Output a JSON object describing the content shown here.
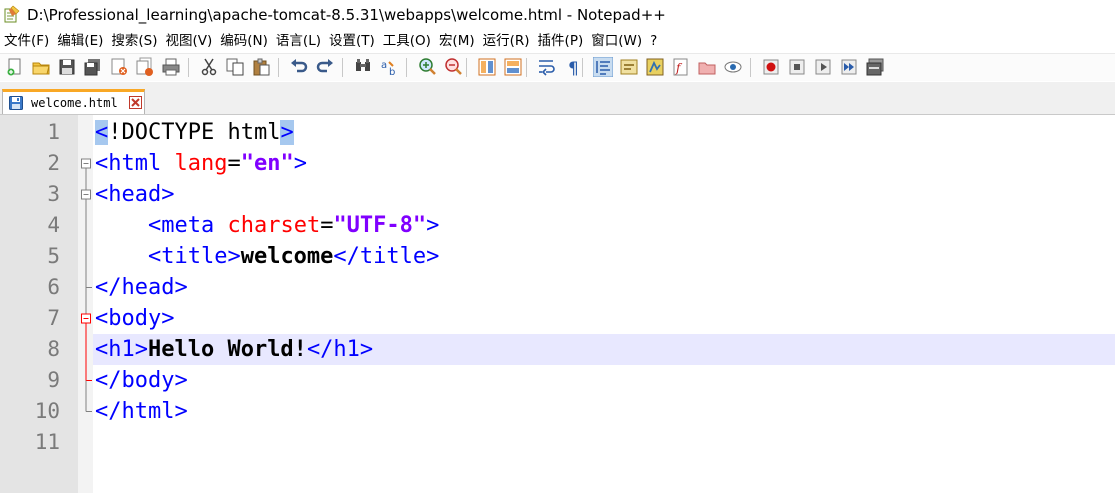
{
  "window": {
    "title": "D:\\Professional_learning\\apache-tomcat-8.5.31\\webapps\\welcome.html - Notepad++",
    "app_icon": "notepad-plus-plus-icon"
  },
  "menu": [
    {
      "label": "文件(F)"
    },
    {
      "label": "编辑(E)"
    },
    {
      "label": "搜索(S)"
    },
    {
      "label": "视图(V)"
    },
    {
      "label": "编码(N)"
    },
    {
      "label": "语言(L)"
    },
    {
      "label": "设置(T)"
    },
    {
      "label": "工具(O)"
    },
    {
      "label": "宏(M)"
    },
    {
      "label": "运行(R)"
    },
    {
      "label": "插件(P)"
    },
    {
      "label": "窗口(W)"
    },
    {
      "label": "?"
    }
  ],
  "toolbar": {
    "buttons": [
      "new-file-icon",
      "open-file-icon",
      "save-icon",
      "save-all-icon",
      "close-icon",
      "close-all-icon",
      "print-icon",
      "cut-icon",
      "copy-icon",
      "paste-icon",
      "undo-icon",
      "redo-icon",
      "find-icon",
      "replace-icon",
      "zoom-in-icon",
      "zoom-out-icon",
      "sync-vertical-icon",
      "sync-horizontal-icon",
      "word-wrap-icon",
      "show-all-characters-icon",
      "indent-guide-icon",
      "user-language-icon",
      "document-map-icon",
      "function-list-icon",
      "folder-as-workspace-icon",
      "monitoring-icon",
      "record-macro-icon",
      "stop-recording-icon",
      "playback-icon",
      "run-macro-multiple-icon",
      "save-macro-icon"
    ],
    "active_button": "indent-guide-icon"
  },
  "tabs": [
    {
      "label": "welcome.html",
      "icon": "saved-file-icon",
      "close_icon": "tab-close-icon",
      "active": true
    }
  ],
  "editor": {
    "current_line": 8,
    "line_numbers": [
      "1",
      "2",
      "3",
      "4",
      "5",
      "6",
      "7",
      "8",
      "9",
      "10",
      "11"
    ],
    "lines": [
      {
        "n": 1,
        "indent": "",
        "tokens": [
          {
            "t": "<",
            "c": "tag hl-bracket"
          },
          {
            "t": "!DOCTYPE html",
            "c": "doct"
          },
          {
            "t": ">",
            "c": "tag hl-bracket"
          }
        ]
      },
      {
        "n": 2,
        "indent": "",
        "tokens": [
          {
            "t": "<html ",
            "c": "tag"
          },
          {
            "t": "lang",
            "c": "attr"
          },
          {
            "t": "=",
            "c": "eq"
          },
          {
            "t": "\"en\"",
            "c": "val"
          },
          {
            "t": ">",
            "c": "tag"
          }
        ]
      },
      {
        "n": 3,
        "indent": "",
        "tokens": [
          {
            "t": "<head>",
            "c": "tag"
          }
        ]
      },
      {
        "n": 4,
        "indent": "    ",
        "tokens": [
          {
            "t": "<meta ",
            "c": "tag"
          },
          {
            "t": "charset",
            "c": "attr"
          },
          {
            "t": "=",
            "c": "eq"
          },
          {
            "t": "\"UTF-8\"",
            "c": "val"
          },
          {
            "t": ">",
            "c": "tag"
          }
        ]
      },
      {
        "n": 5,
        "indent": "    ",
        "tokens": [
          {
            "t": "<title>",
            "c": "tag"
          },
          {
            "t": "welcome",
            "c": "txt"
          },
          {
            "t": "</title>",
            "c": "tag"
          }
        ]
      },
      {
        "n": 6,
        "indent": "",
        "tokens": [
          {
            "t": "</head>",
            "c": "tag"
          }
        ]
      },
      {
        "n": 7,
        "indent": "",
        "tokens": [
          {
            "t": "<body>",
            "c": "tag"
          }
        ]
      },
      {
        "n": 8,
        "indent": "",
        "tokens": [
          {
            "t": "<h1>",
            "c": "tag"
          },
          {
            "t": "Hello World!",
            "c": "txt"
          },
          {
            "t": "</h1>",
            "c": "tag"
          }
        ]
      },
      {
        "n": 9,
        "indent": "",
        "tokens": [
          {
            "t": "</body>",
            "c": "tag"
          }
        ]
      },
      {
        "n": 10,
        "indent": "",
        "tokens": [
          {
            "t": "</html>",
            "c": "tag"
          }
        ]
      },
      {
        "n": 11,
        "indent": "",
        "tokens": []
      }
    ]
  },
  "colors": {
    "tag": "#0000ff",
    "attribute": "#ff0000",
    "attribute_value": "#8000ff",
    "text": "#000000",
    "line_number": "#7a7a7a",
    "gutter": "#e4e4e4",
    "current_line_highlight": "#e8e8ff",
    "bracket_match": "#a6c8ef",
    "fold_html": "#808080",
    "fold_body": "#ff0000",
    "active_tab_accent": "#f9a825"
  }
}
